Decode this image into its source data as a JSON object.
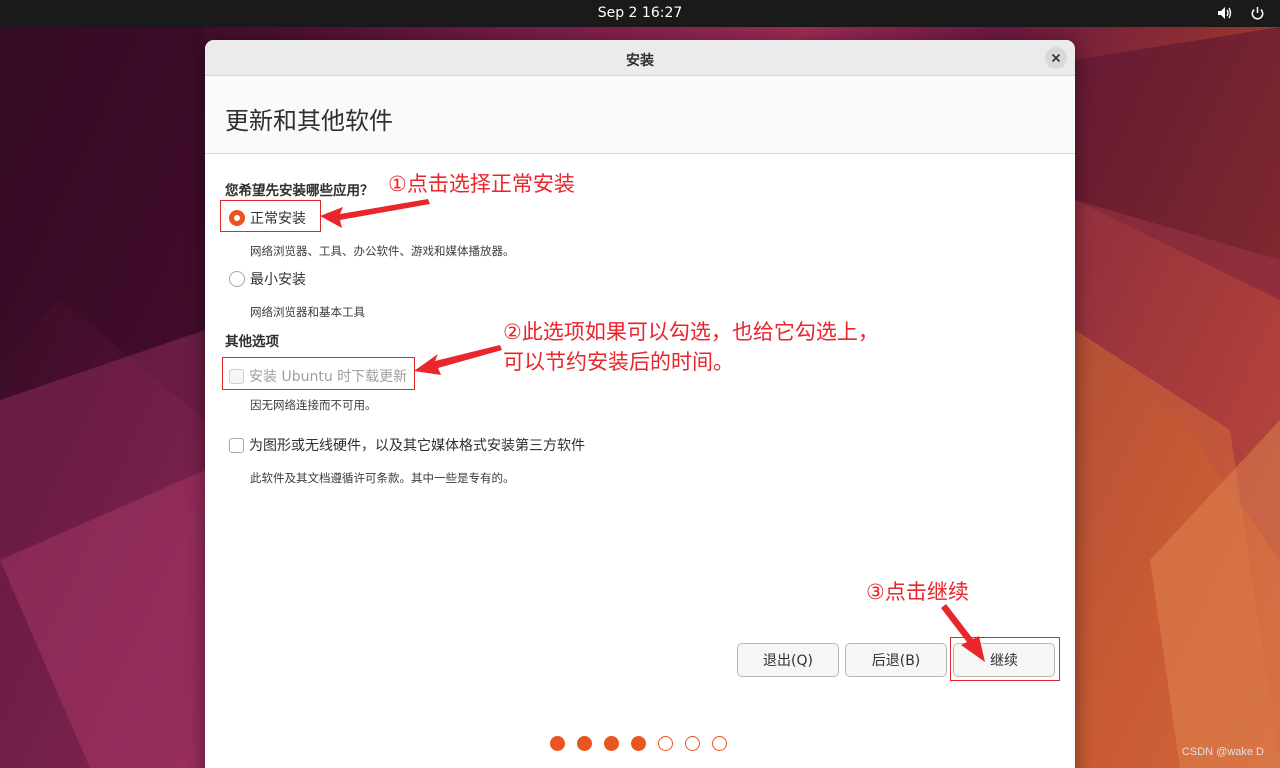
{
  "topbar": {
    "clock": "Sep 2  16:27",
    "icons": [
      "volume-icon",
      "power-icon"
    ]
  },
  "window": {
    "title": "安装",
    "page_heading": "更新和其他软件",
    "install_question": "您希望先安装哪些应用？",
    "options": {
      "normal": {
        "label": "正常安装",
        "desc": "网络浏览器、工具、办公软件、游戏和媒体播放器。",
        "checked": true
      },
      "minimal": {
        "label": "最小安装",
        "desc": "网络浏览器和基本工具",
        "checked": false
      }
    },
    "other_options_title": "其他选项",
    "download_updates": {
      "label": "安装 Ubuntu 时下载更新",
      "desc": "因无网络连接而不可用。",
      "enabled": false,
      "checked": false
    },
    "third_party": {
      "label": "为图形或无线硬件，以及其它媒体格式安装第三方软件",
      "desc": "此软件及其文档遵循许可条款。其中一些是专有的。",
      "checked": false
    },
    "buttons": {
      "quit": "退出(Q)",
      "back": "后退(B)",
      "continue": "继续"
    },
    "progress": {
      "total": 7,
      "completed": 4
    }
  },
  "annotations": {
    "step1": "①点击选择正常安装",
    "step2_line1": "②此选项如果可以勾选，也给它勾选上，",
    "step2_line2": "可以节约安装后的时间。",
    "step3": "③点击继续"
  },
  "watermark": "CSDN @wake D",
  "colors": {
    "accent": "#e95420",
    "annotation": "#e8262c"
  }
}
